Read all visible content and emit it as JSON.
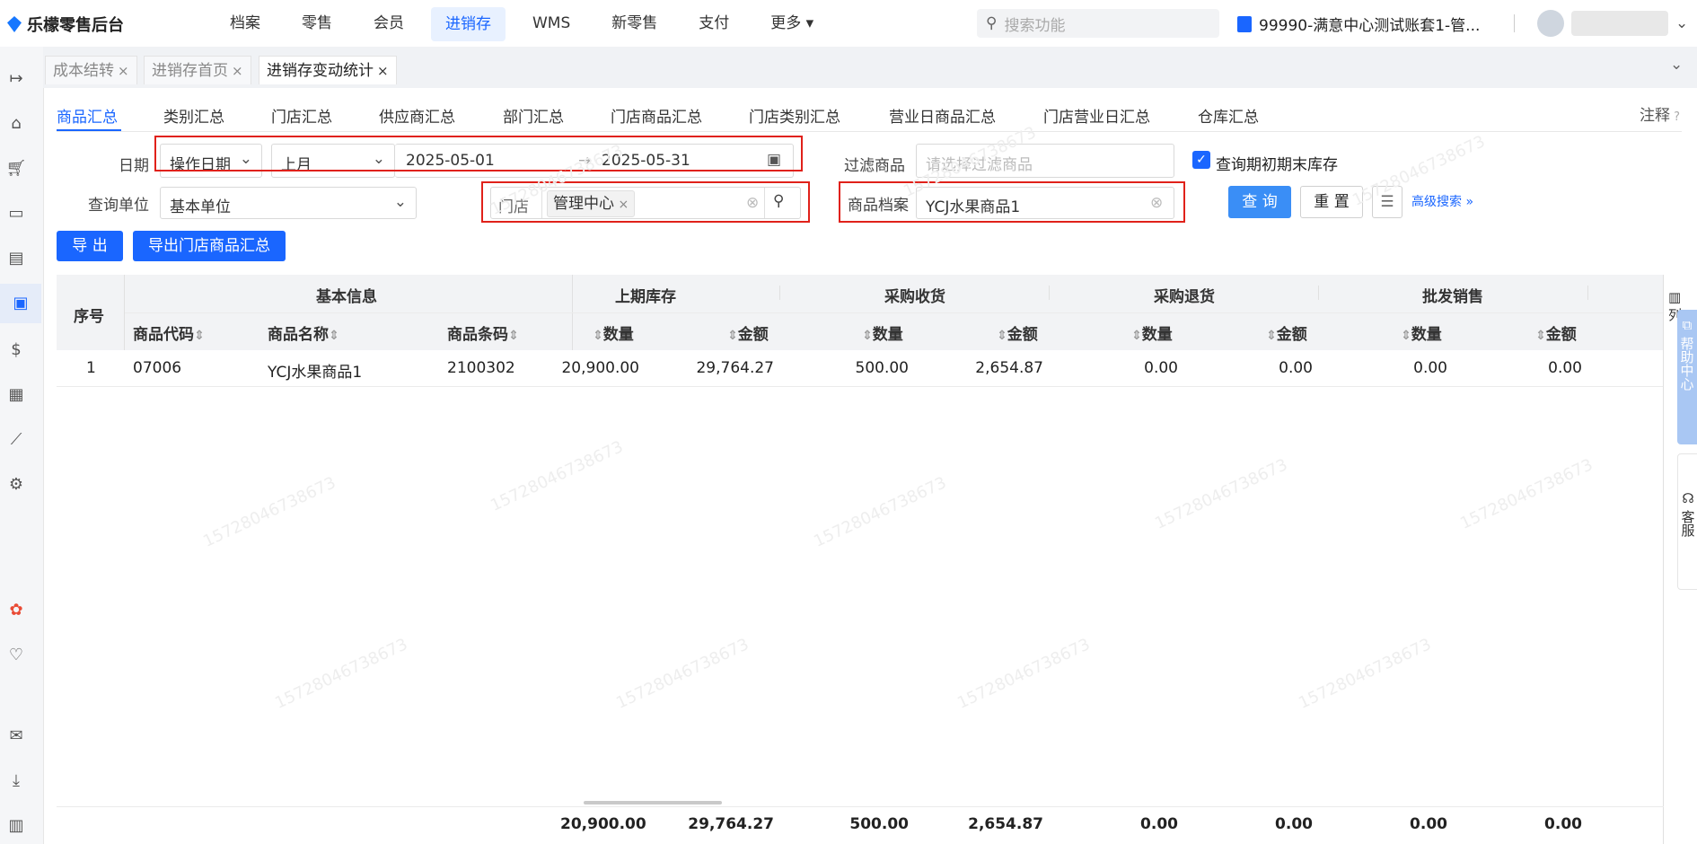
{
  "app": {
    "title": "乐檬零售后台"
  },
  "topnav": [
    "档案",
    "零售",
    "会员",
    "进销存",
    "WMS",
    "新零售",
    "支付",
    "更多"
  ],
  "topnav_active_index": 3,
  "search": {
    "placeholder": "搜索功能"
  },
  "account": {
    "label": "99990-满意中心测试账套1-管..."
  },
  "page_tabs": [
    {
      "label": "成本结转",
      "close": "×"
    },
    {
      "label": "进销存首页",
      "close": "×"
    },
    {
      "label": "进销存变动统计",
      "close": "×"
    }
  ],
  "sub_tabs": [
    "商品汇总",
    "类别汇总",
    "门店汇总",
    "供应商汇总",
    "部门汇总",
    "门店商品汇总",
    "门店类别汇总",
    "营业日商品汇总",
    "门店营业日汇总",
    "仓库汇总"
  ],
  "note_label": "注释",
  "form": {
    "date_label": "日期",
    "date_type": "操作日期",
    "period": "上月",
    "date_start": "2025-05-01",
    "date_arrow": "→",
    "date_end": "2025-05-31",
    "filter_label": "过滤商品",
    "filter_placeholder": "请选择过滤商品",
    "checkbox_label": "查询期初期末库存",
    "unit_label": "查询单位",
    "unit_value": "基本单位",
    "store_label": "门店",
    "store_chip": "管理中心",
    "goods_label": "商品档案",
    "goods_value": "YCJ水果商品1",
    "query_btn": "查 询",
    "reset_btn": "重 置",
    "advanced": "高级搜索"
  },
  "actions": {
    "export": "导 出",
    "export_store": "导出门店商品汇总"
  },
  "table": {
    "seq_header": "序号",
    "groups": [
      "基本信息",
      "上期库存",
      "采购收货",
      "采购退货",
      "批发销售"
    ],
    "basic_cols": [
      "商品代码",
      "商品名称",
      "商品条码"
    ],
    "qty_label": "数量",
    "amt_label": "金额",
    "row": {
      "seq": "1",
      "code": "07006",
      "name": "YCJ水果商品1",
      "barcode": "2100302",
      "prev_qty": "20,900.00",
      "prev_amt": "29,764.27",
      "recv_qty": "500.00",
      "recv_amt": "2,654.87",
      "ret_qty": "0.00",
      "ret_amt": "0.00",
      "ws_qty": "0.00",
      "ws_amt": "0.00"
    },
    "summary": {
      "prev_qty": "20,900.00",
      "prev_amt": "29,764.27",
      "recv_qty": "500.00",
      "recv_amt": "2,654.87",
      "ret_qty": "0.00",
      "ret_amt": "0.00",
      "ws_qty": "0.00",
      "ws_amt": "0.00"
    },
    "col_settings": "列"
  },
  "right_float": {
    "help": "帮助中心",
    "service": "客服"
  },
  "watermark": "15728046738673"
}
